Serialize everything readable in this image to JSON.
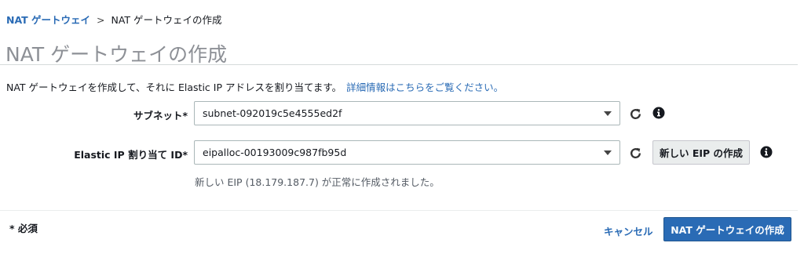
{
  "breadcrumb": {
    "link_label": "NAT ゲートウェイ",
    "separator": ">",
    "current": "NAT ゲートウェイの作成"
  },
  "page": {
    "title": "NAT ゲートウェイの作成",
    "description": "NAT ゲートウェイを作成して、それに Elastic IP アドレスを割り当てます。",
    "details_link": "詳細情報はこちらをご覧ください。"
  },
  "form": {
    "subnet": {
      "label": "サブネット*",
      "value": "subnet-092019c5e4555ed2f"
    },
    "eip": {
      "label": "Elastic IP 割り当て ID*",
      "value": "eipalloc-00193009c987fb95d",
      "create_button": "新しい EIP の作成",
      "hint": "新しい EIP (18.179.187.7) が正常に作成されました。"
    }
  },
  "footer": {
    "required_note": "* 必須",
    "cancel_label": "キャンセル",
    "submit_label": "NAT ゲートウェイの作成"
  },
  "icons": {
    "refresh": "refresh-icon",
    "info": "info-icon",
    "caret": "chevron-down-icon"
  },
  "colors": {
    "link": "#2a6bb5",
    "primary_button": "#2a6bb5",
    "title": "#8d9096"
  }
}
